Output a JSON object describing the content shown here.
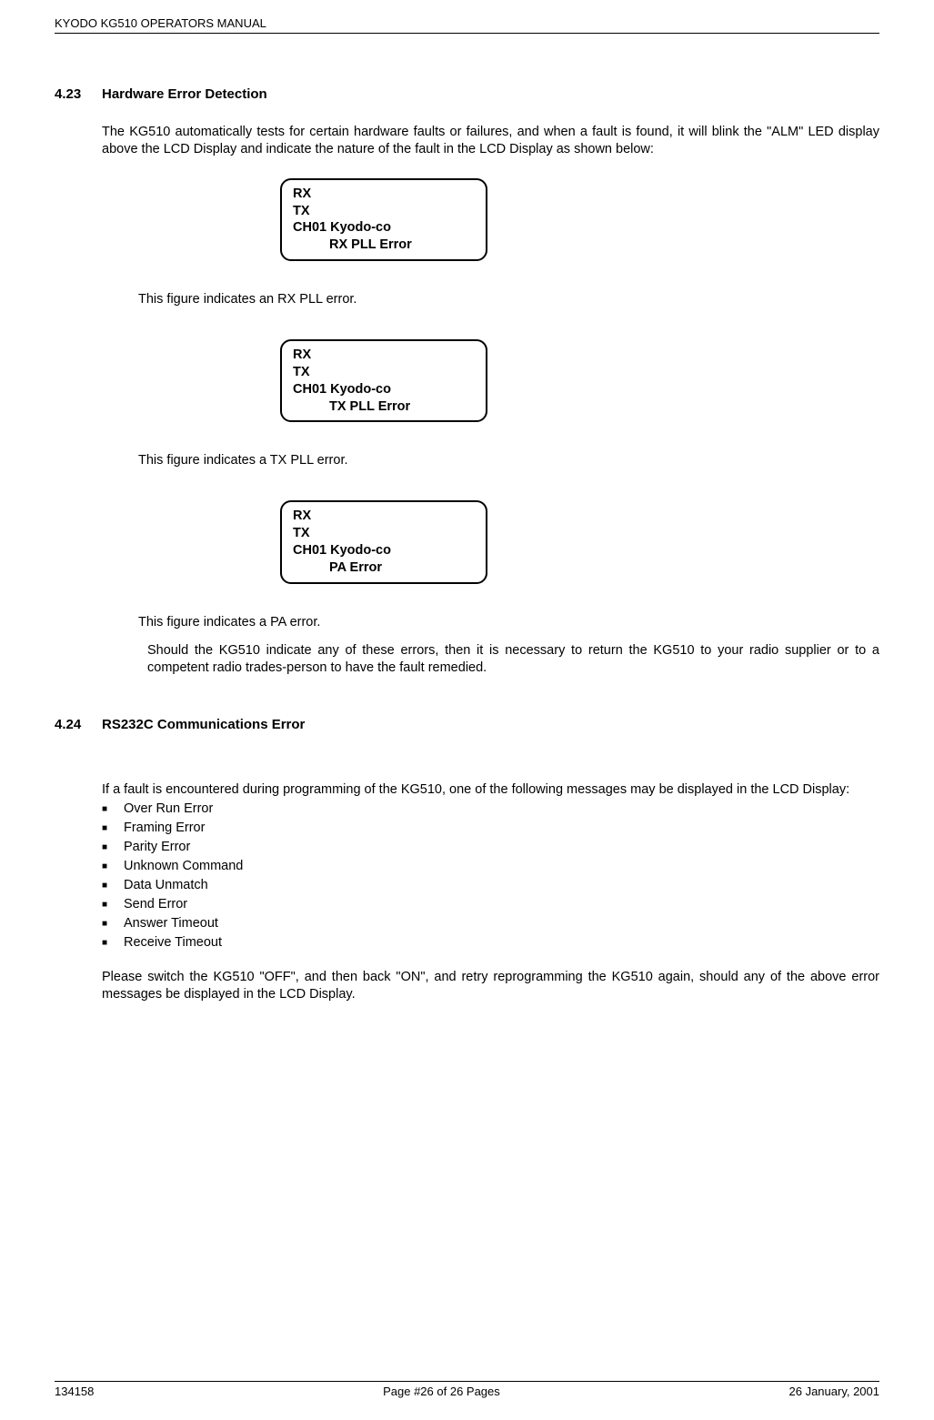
{
  "header": {
    "title": "KYODO KG510 OPERATORS MANUAL"
  },
  "section1": {
    "num": "4.23",
    "title": "Hardware Error Detection",
    "intro": "The KG510 automatically tests for certain hardware faults or failures, and when a fault is found, it will blink the \"ALM\" LED display above the LCD Display and indicate the nature of the fault in the LCD Display as shown below:",
    "lcd1": {
      "l1": "RX",
      "l2": "TX",
      "l3": "CH01  Kyodo-co",
      "l4": "RX PLL Error"
    },
    "caption1": "This figure indicates an RX PLL error.",
    "lcd2": {
      "l1": "RX",
      "l2": "TX",
      "l3": "CH01  Kyodo-co",
      "l4": "TX PLL Error"
    },
    "caption2": "This figure indicates a TX PLL error.",
    "lcd3": {
      "l1": "RX",
      "l2": "TX",
      "l3": "CH01  Kyodo-co",
      "l4": "PA Error"
    },
    "caption3": "This figure indicates a PA error.",
    "remedy": "Should the KG510 indicate any of these errors, then it is necessary to return the KG510 to your radio supplier or to a competent radio trades-person to have the fault remedied."
  },
  "section2": {
    "num": "4.24",
    "title": "RS232C Communications Error",
    "intro": "If a fault is encountered during programming of the KG510, one of the following messages may be displayed in the LCD Display:",
    "bullets": [
      "Over Run Error",
      "Framing Error",
      "Parity Error",
      "Unknown Command",
      "Data Unmatch",
      "Send Error",
      "Answer Timeout",
      "Receive Timeout"
    ],
    "outro": "Please switch the KG510 \"OFF\", and then back \"ON\", and retry reprogramming the KG510 again, should any of the above error messages be displayed in the LCD Display."
  },
  "footer": {
    "left": "134158",
    "center": "Page #26 of 26 Pages",
    "right": "26 January, 2001"
  }
}
